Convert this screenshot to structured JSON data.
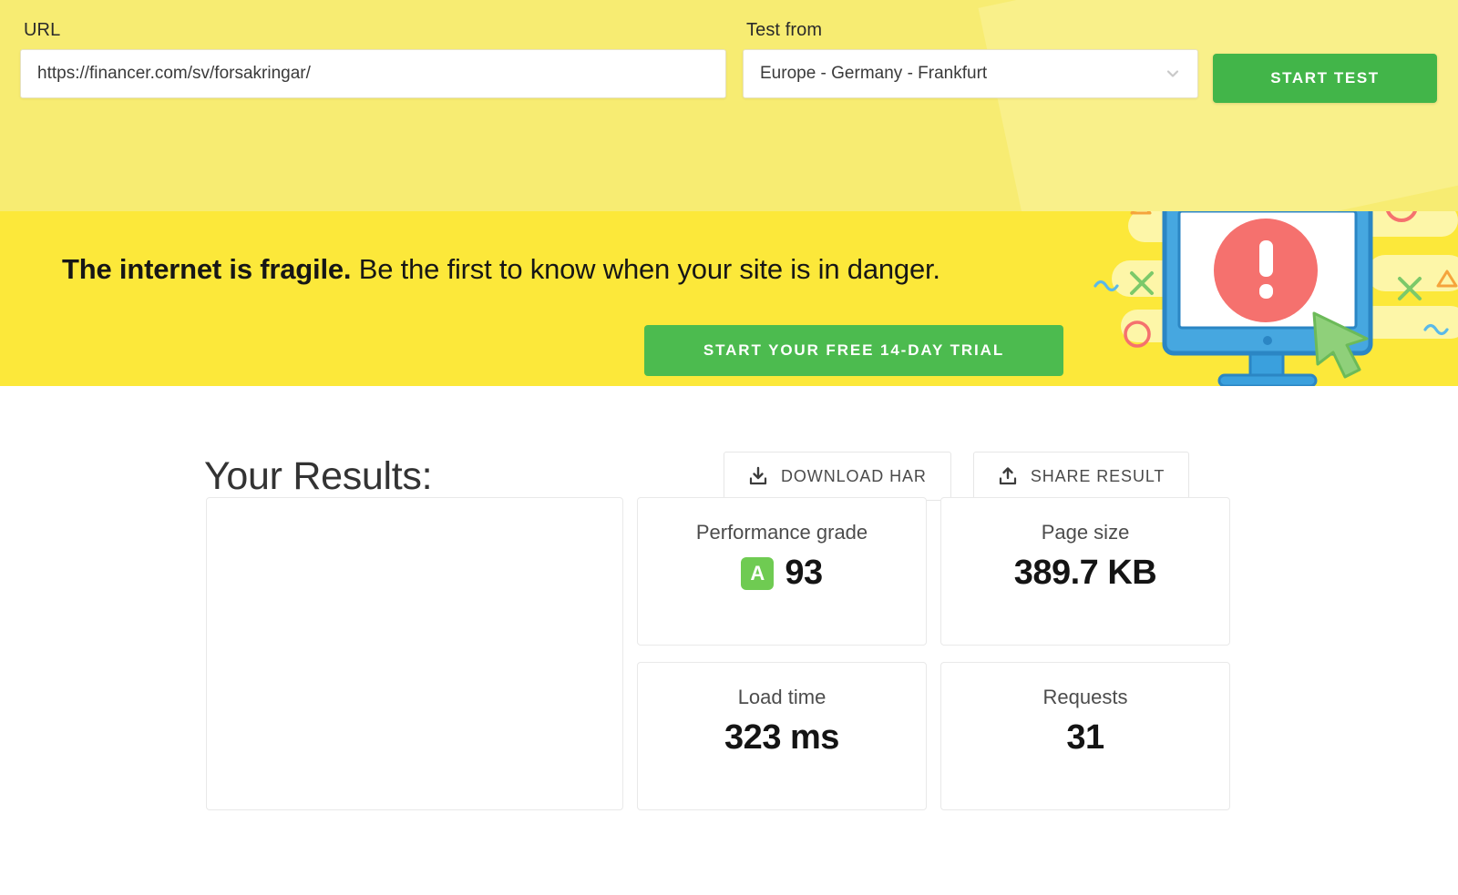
{
  "header": {
    "url_label": "URL",
    "url_value": "https://financer.com/sv/forsakringar/",
    "url_placeholder": "Enter a URL to test",
    "location_label": "Test from",
    "location_value": "Europe - Germany - Frankfurt",
    "start_button": "START TEST",
    "accent_green": "#42b549",
    "background_yellow": "#f7ec72"
  },
  "banner": {
    "headline_bold": "The internet is fragile.",
    "headline_rest": " Be the first to know when your site is in danger.",
    "cta_label": "START YOUR FREE 14-DAY TRIAL",
    "background_yellow": "#fce83a",
    "cta_green": "#4cbb4f",
    "illustration": {
      "name": "monitor-alert-illustration",
      "monitor_color": "#3aa0dd",
      "alert_color": "#f5716e",
      "cursor_color": "#8fd07a"
    }
  },
  "results": {
    "title": "Your Results:",
    "actions": [
      {
        "label": "DOWNLOAD HAR",
        "icon": "download-icon"
      },
      {
        "label": "SHARE RESULT",
        "icon": "share-icon"
      }
    ],
    "cards": [
      {
        "label": "Performance grade",
        "grade": "A",
        "value": "93",
        "grade_color": "#6fcb52"
      },
      {
        "label": "Page size",
        "value": "389.7 KB"
      },
      {
        "label": "Load time",
        "value": "323 ms"
      },
      {
        "label": "Requests",
        "value": "31"
      }
    ]
  }
}
